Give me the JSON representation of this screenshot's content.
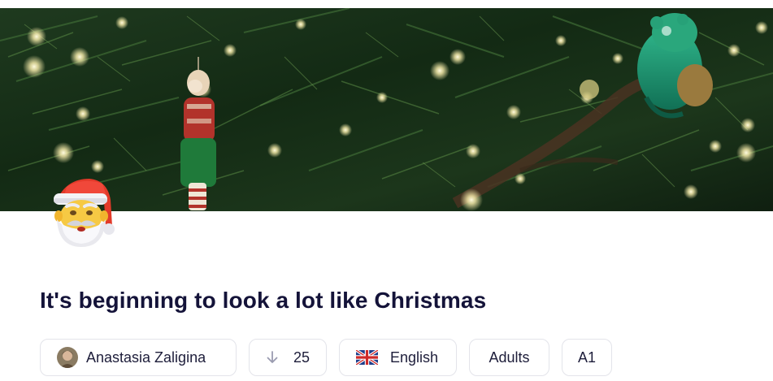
{
  "banner": {
    "image_alt": "Christmas tree with ornaments and lights",
    "icon": "christmas-tree-photo"
  },
  "cover": {
    "icon": "santa-claus-emoji"
  },
  "lesson": {
    "title": "It's beginning to look a lot like Christmas"
  },
  "meta": {
    "author": {
      "name": "Anastasia Zaligina",
      "icon": "avatar"
    },
    "downloads": {
      "count": "25",
      "icon": "arrow-down-icon"
    },
    "language": {
      "label": "English",
      "icon": "uk-flag-icon"
    },
    "audience": "Adults",
    "level": "A1"
  },
  "colors": {
    "title": "#141339",
    "chip_border": "#e3e4ea",
    "chip_text": "#1d1d3a"
  }
}
